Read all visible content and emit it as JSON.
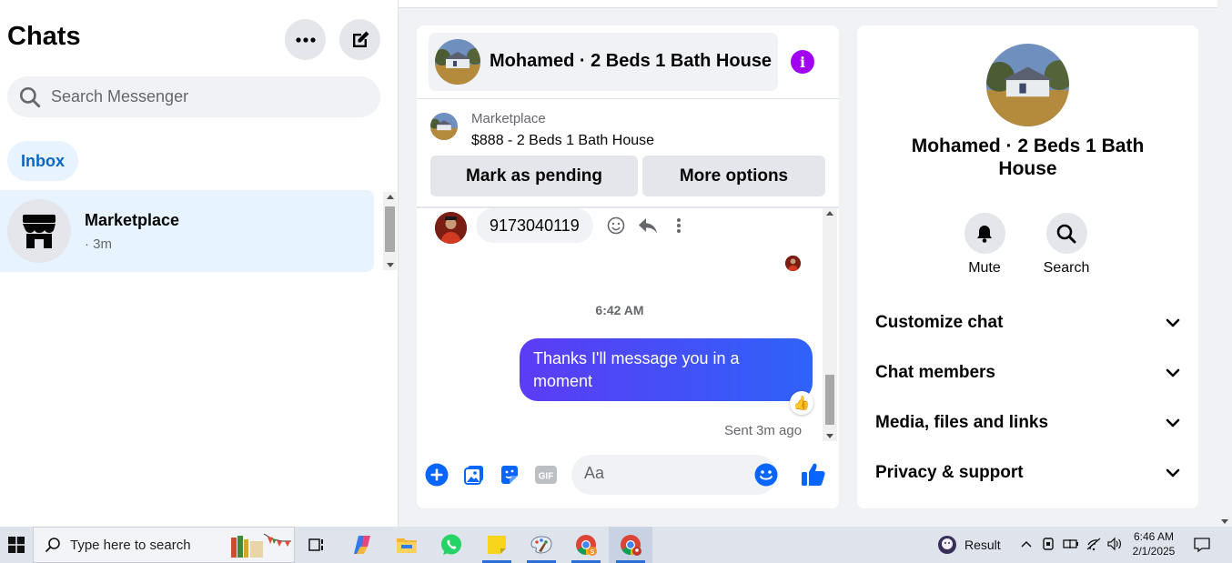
{
  "sidebar": {
    "title": "Chats",
    "search_placeholder": "Search Messenger",
    "filter_inbox": "Inbox",
    "chats": [
      {
        "name": "Marketplace",
        "time": "· 3m",
        "icon": "shop-icon"
      }
    ]
  },
  "conversation": {
    "title": "Mohamed · 2 Beds 1 Bath House",
    "marketplace_label": "Marketplace",
    "listing": "$888 - 2 Beds 1 Bath House",
    "mark_pending": "Mark as pending",
    "more_options": "More options",
    "incoming_message": "9173040119",
    "timestamp": "6:42 AM",
    "outgoing_message": "Thanks I'll message you in a moment",
    "reaction": "👍",
    "sent_status": "Sent 3m ago",
    "composer_placeholder": "Aa"
  },
  "info_panel": {
    "title": "Mohamed · 2 Beds 1 Bath House",
    "actions": [
      {
        "label": "Mute",
        "icon": "bell-icon"
      },
      {
        "label": "Search",
        "icon": "search-icon"
      }
    ],
    "sections": [
      "Customize chat",
      "Chat members",
      "Media, files and links",
      "Privacy & support"
    ]
  },
  "taskbar": {
    "search_placeholder": "Type here to search",
    "result_label": "Result",
    "time": "6:46 AM",
    "date": "2/1/2025"
  },
  "colors": {
    "accent": "#0866ff",
    "info_button": "#a100f2",
    "bubble_start": "#5c3cf6",
    "bubble_end": "#2f62f8",
    "selected_chat": "#e7f3ff"
  }
}
